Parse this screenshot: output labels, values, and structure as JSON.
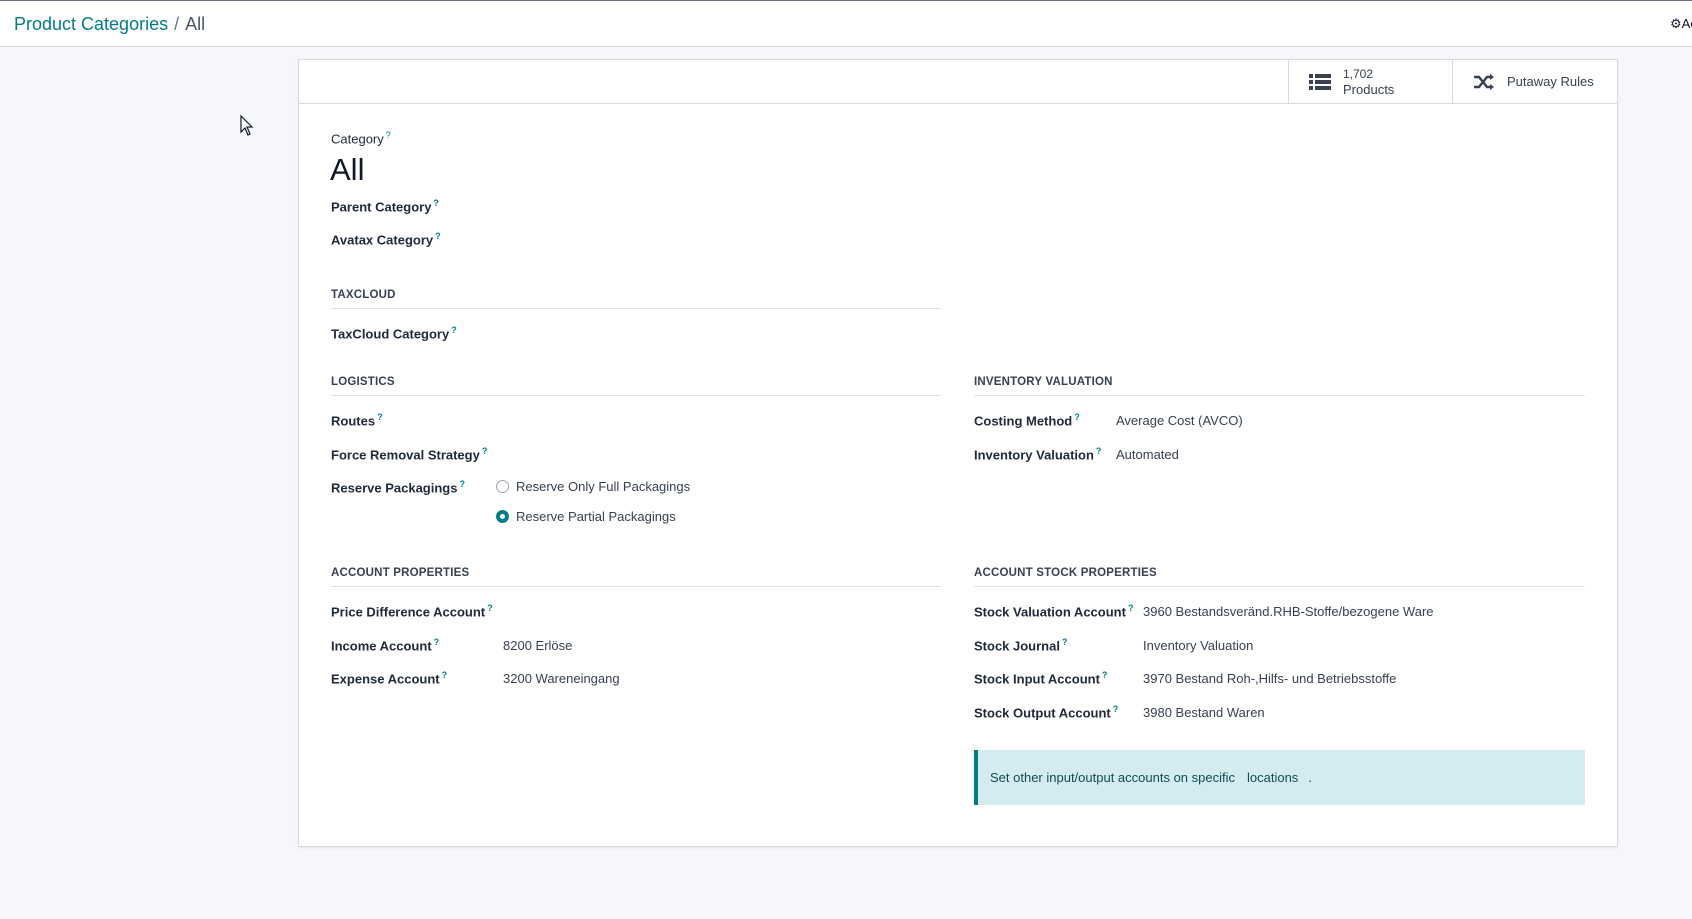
{
  "breadcrumb": {
    "parent": "Product Categories",
    "separator": "/",
    "current": "All"
  },
  "action_menu": {
    "label": "Action"
  },
  "smart_buttons": {
    "products": {
      "value": "1,702",
      "label": "Products"
    },
    "putaway": {
      "label": "Putaway Rules"
    }
  },
  "title": {
    "label": "Category",
    "value": "All"
  },
  "fields": {
    "parent_category": "Parent Category",
    "avatax_category": "Avatax Category"
  },
  "sections": {
    "taxcloud": {
      "title": "TAXCLOUD",
      "category_label": "TaxCloud Category"
    },
    "logistics": {
      "title": "LOGISTICS",
      "routes_label": "Routes",
      "removal_label": "Force Removal Strategy",
      "reserve_label": "Reserve Packagings",
      "reserve_options": [
        {
          "label": "Reserve Only Full Packagings",
          "checked": false
        },
        {
          "label": "Reserve Partial Packagings",
          "checked": true
        }
      ]
    },
    "inventory_valuation": {
      "title": "INVENTORY VALUATION",
      "costing_label": "Costing Method",
      "costing_value": "Average Cost (AVCO)",
      "valuation_label": "Inventory Valuation",
      "valuation_value": "Automated"
    },
    "account_properties": {
      "title": "ACCOUNT PROPERTIES",
      "price_diff_label": "Price Difference Account",
      "income_label": "Income Account",
      "income_value": "8200 Erlöse",
      "expense_label": "Expense Account",
      "expense_value": "3200 Wareneingang"
    },
    "account_stock_properties": {
      "title": "ACCOUNT STOCK PROPERTIES",
      "valuation_account_label": "Stock Valuation Account",
      "valuation_account_value": "3960 Bestandsveränd.RHB-Stoffe/bezogene Ware",
      "journal_label": "Stock Journal",
      "journal_value": "Inventory Valuation",
      "input_label": "Stock Input Account",
      "input_value": "3970 Bestand Roh-,Hilfs- und Betriebsstoffe",
      "output_label": "Stock Output Account",
      "output_value": "3980 Bestand Waren"
    }
  },
  "alert": {
    "text": "Set other input/output accounts on specific",
    "link": "locations",
    "suffix": "."
  },
  "colors": {
    "accent": "#017e84",
    "alert_bg": "#d4ecf0"
  },
  "help_marker": "?"
}
